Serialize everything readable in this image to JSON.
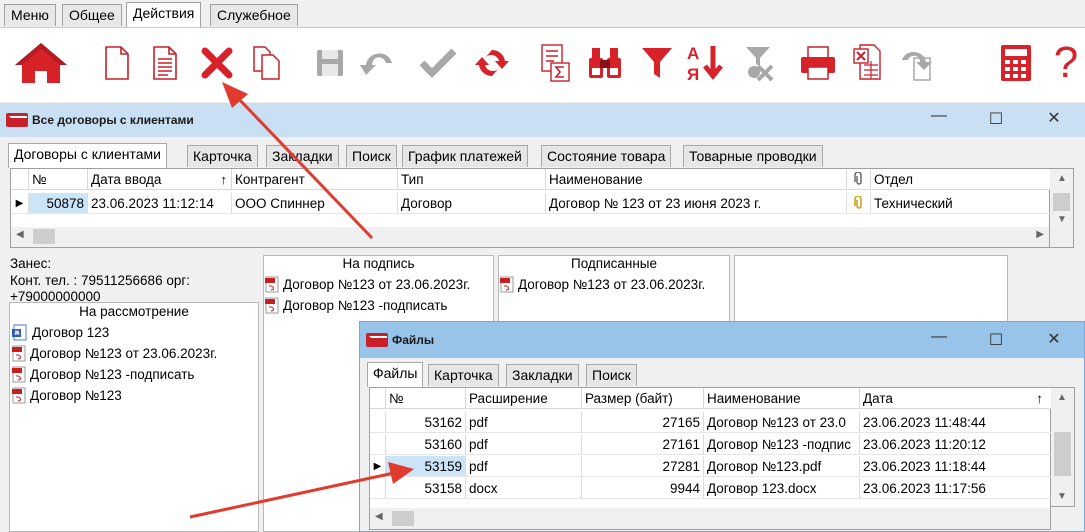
{
  "menu_tabs": [
    "Меню",
    "Общее",
    "Действия",
    "Служебное"
  ],
  "active_menu_tab": "Действия",
  "toolbar": {
    "icons": [
      "home-icon",
      "new-document-icon",
      "edit-document-icon",
      "delete-icon",
      "copy-icon",
      "save-icon",
      "undo-icon",
      "apply-icon",
      "refresh-icon",
      "formula-icon",
      "binoculars-icon",
      "filter-icon",
      "sort-icon",
      "clear-filter-icon",
      "print-icon",
      "excel-icon",
      "redo-icon",
      "calculator-icon",
      "help-icon"
    ],
    "help_label": "?",
    "colors": {
      "accent": "#d8222a",
      "disabled": "#a8a8a8"
    }
  },
  "main_window": {
    "title": "Все договоры с клиентами",
    "tabs": [
      "Договоры с клиентами",
      "Карточка",
      "Закладки",
      "Поиск",
      "График платежей",
      "Состояние товара",
      "Товарные проводки"
    ],
    "grid": {
      "columns": [
        "№",
        "Дата ввода",
        "Контрагент",
        "Тип",
        "Наименование",
        "Отдел"
      ],
      "rows": [
        {
          "id": "50878",
          "date": "23.06.2023 11:12:14",
          "counterparty": "ООО Спиннер",
          "type": "Договор",
          "name": "Договор № 123 от 23 июня 2023 г.",
          "department": "Технический"
        }
      ]
    },
    "info": {
      "line1": "Занес:",
      "line2": "Конт. тел. : 79511256686 орг:",
      "line3": "+79000000000"
    },
    "review_panel": {
      "title": "На рассмотрение",
      "items": [
        "Договор 123",
        "Договор №123 от 23.06.2023г.",
        "Договор №123 -подписать",
        "Договор №123"
      ]
    },
    "signing_panel": {
      "title": "На подпись",
      "items": [
        "Договор №123 от 23.06.2023г.",
        "Договор №123 -подписать"
      ]
    },
    "signed_panel": {
      "title": "Подписанные",
      "items": [
        "Договор №123 от 23.06.2023г."
      ]
    }
  },
  "files_dialog": {
    "title": "Файлы",
    "tabs": [
      "Файлы",
      "Карточка",
      "Закладки",
      "Поиск"
    ],
    "columns": [
      "№",
      "Расширение",
      "Размер (байт)",
      "Наименование",
      "Дата"
    ],
    "rows": [
      {
        "id": "53162",
        "ext": "pdf",
        "size": "27165",
        "name": "Договор №123 от 23.0",
        "date": "23.06.2023 11:48:44"
      },
      {
        "id": "53160",
        "ext": "pdf",
        "size": "27161",
        "name": "Договор №123 -подпис",
        "date": "23.06.2023 11:20:12"
      },
      {
        "id": "53159",
        "ext": "pdf",
        "size": "27281",
        "name": "Договор №123.pdf",
        "date": "23.06.2023 11:18:44"
      },
      {
        "id": "53158",
        "ext": "docx",
        "size": "9944",
        "name": "Договор 123.docx",
        "date": "23.06.2023 11:17:56"
      }
    ]
  }
}
